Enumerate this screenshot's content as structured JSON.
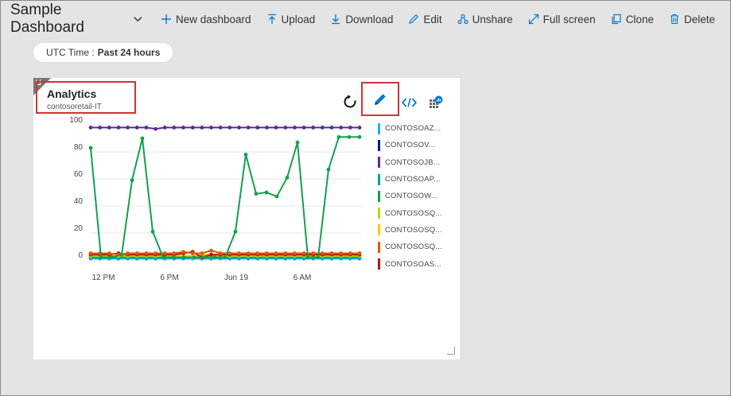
{
  "header": {
    "title": "Sample Dashboard",
    "toolbar": [
      {
        "label": "New dashboard",
        "icon": "plus-icon"
      },
      {
        "label": "Upload",
        "icon": "upload-icon"
      },
      {
        "label": "Download",
        "icon": "download-icon"
      },
      {
        "label": "Edit",
        "icon": "pencil-icon"
      },
      {
        "label": "Unshare",
        "icon": "unshare-icon"
      },
      {
        "label": "Full screen",
        "icon": "fullscreen-icon"
      },
      {
        "label": "Clone",
        "icon": "clone-icon"
      },
      {
        "label": "Delete",
        "icon": "trash-icon"
      }
    ]
  },
  "time_filter": {
    "label": "UTC Time :",
    "value": "Past 24 hours"
  },
  "tile": {
    "title": "Analytics",
    "subtitle": "contosoretail-IT",
    "accent_color": "#0078d4",
    "highlight_color": "#d13438"
  },
  "chart_data": {
    "type": "line",
    "ylim": [
      0,
      100
    ],
    "yticks": [
      "100",
      "80",
      "60",
      "40",
      "20",
      "0"
    ],
    "xticks": [
      "12 PM",
      "6 PM",
      "Jun 19",
      "6 AM"
    ],
    "grid": true,
    "legend_position": "right",
    "series": [
      {
        "name": "CONTOSOAZ...",
        "color": "#1fb0f0",
        "values": [
          1,
          1,
          1,
          1,
          1,
          1,
          1,
          1,
          1,
          1,
          1,
          1,
          1,
          1,
          1,
          1,
          1,
          1,
          1,
          1,
          1,
          1,
          1,
          1,
          1,
          1,
          1,
          1,
          1,
          1
        ]
      },
      {
        "name": "CONTOSOV...",
        "color": "#0a1f7a",
        "values": [
          2,
          2,
          2,
          2,
          2,
          2,
          2,
          2,
          2,
          2,
          2,
          2,
          2,
          2,
          2,
          2,
          2,
          2,
          2,
          2,
          2,
          2,
          2,
          2,
          2,
          2,
          2,
          2,
          2,
          2
        ]
      },
      {
        "name": "CONTOSOJB...",
        "color": "#5c2d91",
        "values": [
          98,
          98,
          98,
          98,
          98,
          98,
          98,
          97,
          98,
          98,
          98,
          98,
          98,
          98,
          98,
          98,
          98,
          98,
          98,
          98,
          98,
          98,
          98,
          98,
          98,
          98,
          98,
          98,
          98,
          98
        ]
      },
      {
        "name": "CONTOSOAP...",
        "color": "#00a591",
        "values": [
          2,
          2,
          2,
          2,
          2,
          2,
          2,
          2,
          2,
          2,
          2,
          2,
          2,
          2,
          2,
          2,
          2,
          2,
          2,
          2,
          2,
          2,
          2,
          2,
          2,
          2,
          2,
          2,
          2,
          2
        ]
      },
      {
        "name": "CONTOSOW...",
        "color": "#14a04a",
        "values": [
          83,
          2,
          2,
          4,
          59,
          90,
          21,
          2,
          2,
          2,
          2,
          2,
          2,
          2,
          21,
          78,
          49,
          50,
          47,
          61,
          87,
          2,
          2,
          67,
          91,
          91,
          91
        ]
      },
      {
        "name": "CONTOSOSQ...",
        "color": "#bad80a",
        "values": [
          3,
          3,
          3,
          3,
          3,
          3,
          3,
          3,
          3,
          3,
          3,
          3,
          3,
          3,
          3,
          3,
          3,
          3,
          3,
          3,
          3,
          3,
          3,
          3,
          3,
          3,
          3,
          3,
          3,
          3
        ]
      },
      {
        "name": "CONTOSOSQ...",
        "color": "#ffc800",
        "values": [
          4,
          4,
          4,
          4,
          4,
          4,
          4,
          4,
          4,
          4,
          3,
          2,
          4,
          4,
          4,
          4,
          4,
          4,
          4,
          4,
          4,
          4,
          4,
          4,
          4,
          4,
          4,
          4,
          4,
          4
        ]
      },
      {
        "name": "CONTOSOSQ...",
        "color": "#e05a00",
        "values": [
          5,
          5,
          5,
          4,
          5,
          5,
          5,
          5,
          5,
          5,
          6,
          5,
          5,
          7,
          5,
          5,
          5,
          5,
          5,
          5,
          5,
          5,
          5,
          5,
          5,
          5,
          5,
          5,
          5,
          5
        ]
      },
      {
        "name": "CONTOSOAS...",
        "color": "#c01010",
        "values": [
          4,
          4,
          4,
          5,
          4,
          4,
          4,
          4,
          4,
          4,
          5,
          6,
          2,
          4,
          4,
          4,
          4,
          4,
          4,
          4,
          4,
          4,
          4,
          4,
          4,
          4,
          4,
          4,
          4,
          4
        ]
      }
    ]
  }
}
